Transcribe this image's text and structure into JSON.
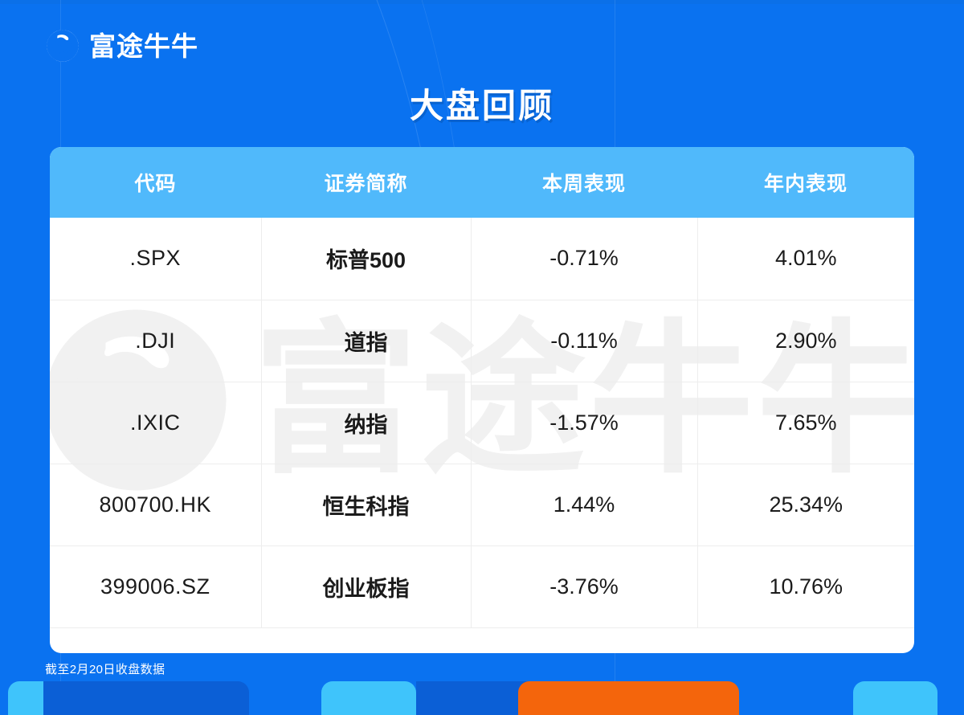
{
  "brand": {
    "name": "富途牛牛",
    "logo_icon": "futu-bull-logo-icon"
  },
  "page": {
    "title": "大盘回顾",
    "background_color": "#0a72f0",
    "card_background": "#ffffff",
    "header_row_color": "#50b9fb",
    "accent_orange": "#f4650c",
    "accent_cyan": "#3fc4fb",
    "accent_deep_blue": "#0b5fd6"
  },
  "watermark": {
    "text": "富途牛牛",
    "icon": "futu-bull-logo-icon"
  },
  "table": {
    "columns": [
      "代码",
      "证券简称",
      "本周表现",
      "年内表现"
    ],
    "rows": [
      {
        "code": ".SPX",
        "name": "标普500",
        "week": "-0.71%",
        "ytd": "4.01%"
      },
      {
        "code": ".DJI",
        "name": "道指",
        "week": "-0.11%",
        "ytd": "2.90%"
      },
      {
        "code": ".IXIC",
        "name": "纳指",
        "week": "-1.57%",
        "ytd": "7.65%"
      },
      {
        "code": "800700.HK",
        "name": "恒生科指",
        "week": "1.44%",
        "ytd": "25.34%"
      },
      {
        "code": "399006.SZ",
        "name": "创业板指",
        "week": "-3.76%",
        "ytd": "10.76%"
      }
    ]
  },
  "footnote": "截至2月20日收盘数据"
}
